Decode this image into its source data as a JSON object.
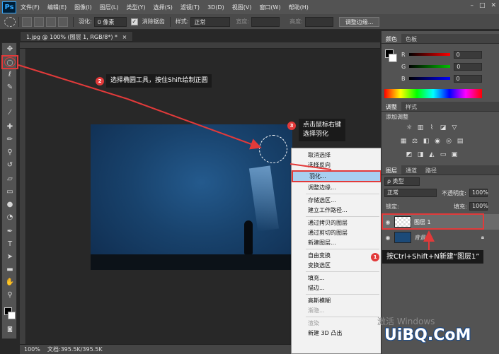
{
  "app": {
    "logo": "Ps"
  },
  "menubar": {
    "items": [
      "文件(F)",
      "编辑(E)",
      "图像(I)",
      "图层(L)",
      "类型(Y)",
      "选择(S)",
      "滤镜(T)",
      "3D(D)",
      "视图(V)",
      "窗口(W)",
      "帮助(H)"
    ],
    "window_controls": [
      "–",
      "□",
      "✕"
    ]
  },
  "optionsbar": {
    "feather_label": "羽化:",
    "feather_value": "0 像素",
    "antialias_label": "消除锯齿",
    "style_label": "样式:",
    "style_value": "正常",
    "width_label": "宽度:",
    "height_label": "高度:",
    "refine_button": "调整边缘..."
  },
  "document": {
    "tab_title": "1.jpg @ 100% (图层 1, RGB/8*) *",
    "tab_close": "×"
  },
  "statusbar": {
    "zoom": "100%",
    "doc_info": "文档:395.5K/395.5K"
  },
  "context_menu": {
    "items": [
      {
        "label": "取消选择",
        "disabled": false
      },
      {
        "label": "选择反向",
        "disabled": false
      },
      {
        "label": "羽化...",
        "disabled": false,
        "highlighted": true
      },
      {
        "label": "调整边缘...",
        "disabled": false
      },
      {
        "label": "存储选区...",
        "disabled": false
      },
      {
        "label": "建立工作路径...",
        "disabled": false
      },
      {
        "label": "通过拷贝的图层",
        "disabled": false
      },
      {
        "label": "通过剪切的图层",
        "disabled": false
      },
      {
        "label": "新建图层...",
        "disabled": false
      },
      {
        "label": "自由变换",
        "disabled": false
      },
      {
        "label": "变换选区",
        "disabled": false
      },
      {
        "label": "填充...",
        "disabled": false
      },
      {
        "label": "描边...",
        "disabled": false
      },
      {
        "label": "高斯模糊",
        "disabled": false
      },
      {
        "label": "渐隐...",
        "disabled": true
      },
      {
        "label": "渲染",
        "disabled": true
      },
      {
        "label": "新建 3D 凸出",
        "disabled": false
      }
    ]
  },
  "annotations": {
    "step1": {
      "number": "1",
      "text": "按Ctrl+Shift+N新建“图层1”"
    },
    "step2": {
      "number": "2",
      "text": "选择椭圆工具，按住Shift绘制正圆"
    },
    "step3": {
      "number": "3",
      "text_line1": "点击鼠标右键",
      "text_line2": "选择羽化"
    },
    "accent_color": "#e23a3a"
  },
  "color_panel": {
    "tabs": [
      "颜色",
      "色板"
    ],
    "channels": [
      {
        "label": "R",
        "value": "0"
      },
      {
        "label": "G",
        "value": "0"
      },
      {
        "label": "B",
        "value": "0"
      }
    ]
  },
  "adjust_panel": {
    "tabs": [
      "调整",
      "样式"
    ],
    "heading": "添加调整"
  },
  "layers_panel": {
    "tabs": [
      "图层",
      "通道",
      "路径"
    ],
    "kind_filter": "ρ 类型",
    "blend_mode": "正常",
    "opacity_label": "不透明度:",
    "opacity_value": "100%",
    "lock_label": "锁定:",
    "fill_label": "填充:",
    "fill_value": "100%",
    "layers": [
      {
        "name": "图层 1",
        "selected": true
      },
      {
        "name": "背景",
        "locked": true
      }
    ]
  },
  "watermark": {
    "windows": "激活 Windows",
    "brand": "UiBQ.CoM"
  }
}
